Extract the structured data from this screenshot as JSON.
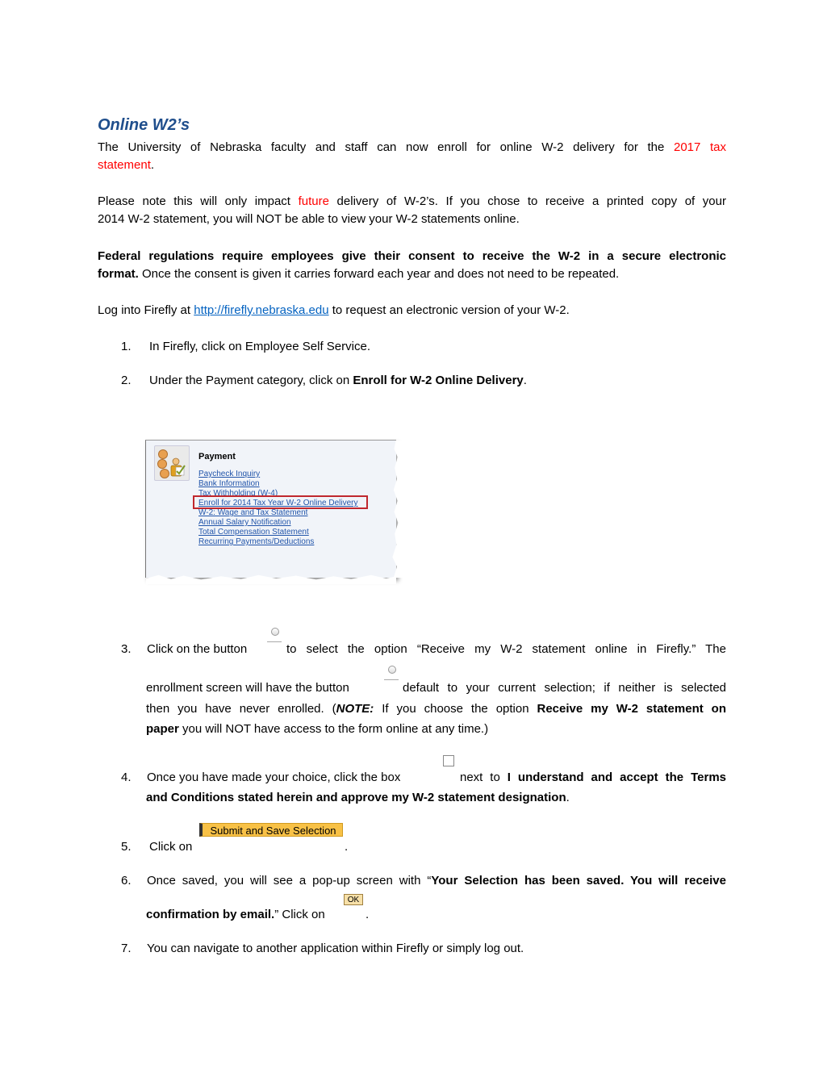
{
  "title": "Online W2’s",
  "intro": {
    "before": "The University of Nebraska faculty and staff can now enroll for online W-2 delivery for the ",
    "highlight_line1": "2017 tax",
    "highlight_line2": "statement",
    "after": "."
  },
  "note": {
    "before": "Please note this will only impact ",
    "highlight": "future",
    "after_line1": " delivery of W-2’s. If you chose to receive a printed copy of your",
    "line2": "2014 W-2 statement, you will NOT be able to view your W-2 statements online."
  },
  "federal": {
    "bold_line1": "Federal regulations require employees give their consent to receive the W-2 in a secure electronic",
    "bold_line2": "format.",
    "rest": " Once the consent is given it carries forward each year and does not need to be repeated."
  },
  "login": {
    "before": "Log into Firefly at ",
    "link": "http://firefly.nebraska.edu",
    "after": " to request an electronic version of your W-2."
  },
  "steps": [
    {
      "num": "1.",
      "text": "In Firefly, click on Employee Self Service."
    },
    {
      "num": "2.",
      "text": "Under the Payment category, click on ",
      "bold": "Enroll for W-2 Online Delivery",
      "after": "."
    },
    {
      "num": "3.",
      "line1_a": "Click on the button",
      "line1_b": "to select the option “Receive my W-2 statement online in Firefly.” The",
      "line2_a": "enrollment screen will have the button",
      "line2_b": "default to your current selection; if neither is selected",
      "line3_a": "then you have never enrolled. (",
      "line3_note": "NOTE:",
      "line3_b": " If you choose the option ",
      "line3_bold": "Receive my W-2 statement on",
      "line4_bold": "paper",
      "line4_rest": " you will NOT have access to the form online at any time.)"
    },
    {
      "num": "4.",
      "line1_a": "Once you have made your choice, click the box",
      "line1_b": "next to ",
      "line1_bold": "I understand and accept the Terms",
      "line2_bold": "and Conditions stated herein and approve my W-2 statement designation",
      "line2_after": "."
    },
    {
      "num": "5.",
      "text": "Click on",
      "after": "."
    },
    {
      "num": "6.",
      "line1_a": "Once saved, you will see a pop-up screen with “",
      "line1_bold": "Your Selection has been saved. You will receive",
      "line2_bold": "confirmation by email.",
      "line2_rest": "” Click on",
      "line2_after": "."
    },
    {
      "num": "7.",
      "text": "You can navigate to another application within Firefly or simply log out."
    }
  ],
  "screenshot": {
    "heading": "Payment",
    "links": [
      "Paycheck Inquiry",
      "Bank Information",
      "Tax Withholding (W-4)",
      "Enroll for 2014 Tax Year W-2 Online Delivery",
      "W-2: Wage and Tax Statement",
      "Annual Salary Notification",
      "Total Compensation Statement",
      "Recurring Payments/Deductions"
    ]
  },
  "buttons": {
    "submit": "Submit and Save Selection",
    "ok": "OK"
  },
  "colors": {
    "title": "#1f4e8c",
    "highlight_red": "#ff0000",
    "link": "#0563c1",
    "submit_bg": "#f8c146",
    "callout_border": "#c0282e"
  }
}
